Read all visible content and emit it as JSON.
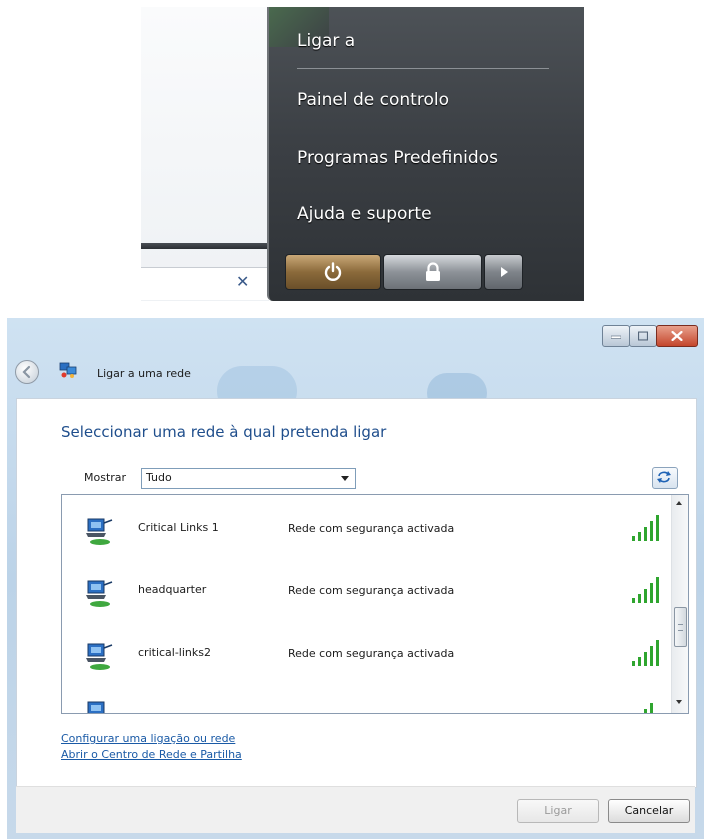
{
  "start_menu": {
    "items": [
      {
        "label": "Ligar a"
      },
      {
        "label": "Painel de controlo"
      },
      {
        "label": "Programas Predefinidos"
      },
      {
        "label": "Ajuda e suporte"
      }
    ],
    "search_clear_glyph": "✕",
    "buttons": {
      "power_icon": "power-icon",
      "lock_icon": "lock-icon",
      "arrow_icon": "arrow-right-icon"
    }
  },
  "dialog": {
    "title": "Ligar a uma rede",
    "heading": "Seleccionar uma rede à qual pretenda ligar",
    "show": {
      "label": "Mostrar",
      "value": "Tudo"
    },
    "networks": [
      {
        "name": "Critical Links 1",
        "security": "Rede com segurança activada"
      },
      {
        "name": "headquarter",
        "security": "Rede com segurança activada"
      },
      {
        "name": "critical-links2",
        "security": "Rede com segurança activada"
      },
      {
        "name": "",
        "security": ""
      }
    ],
    "links": {
      "setup": "Configurar uma ligação ou rede",
      "open_center": "Abrir o Centro de Rede e Partilha"
    },
    "buttons": {
      "connect": "Ligar",
      "cancel": "Cancelar"
    },
    "colors": {
      "heading": "#1f4e8c",
      "link": "#1a5aa6",
      "signal": "#2fa52f",
      "close_button": "#c4462c"
    }
  }
}
